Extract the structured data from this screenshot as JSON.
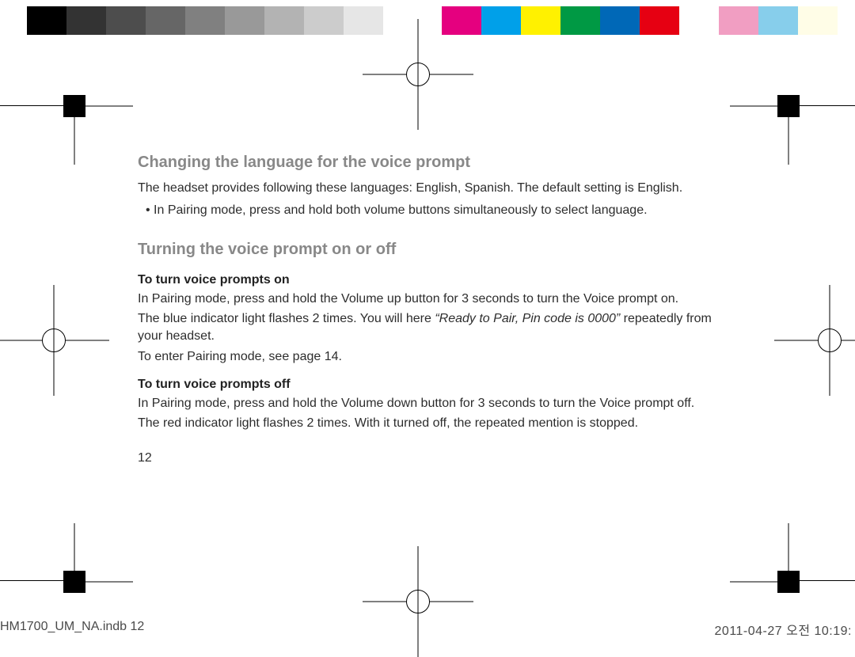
{
  "colorbar": {
    "left": [
      "#000000",
      "#333333",
      "#4d4d4d",
      "#666666",
      "#808080",
      "#999999",
      "#b3b3b3",
      "#cccccc",
      "#e6e6e6",
      "#ffffff"
    ],
    "right": [
      "#e5007f",
      "#00a0e9",
      "#fff100",
      "#009944",
      "#0068b7",
      "#e60012",
      "#ffffff",
      "#f19ec2",
      "#87ceeb",
      "#fffde7"
    ]
  },
  "headings": {
    "h1": "Changing the language for the voice prompt",
    "h2": "Turning the voice prompt on or off"
  },
  "section1": {
    "intro": "The headset provides following these languages: English, Spanish. The default setting is English.",
    "bullet": "In Pairing mode, press and hold both volume buttons simultaneously to select language."
  },
  "section2": {
    "on_title": "To turn voice prompts on",
    "on_p1": "In Pairing mode, press and hold the Volume up button for 3 seconds to turn the Voice prompt on.",
    "on_p2a": "The blue indicator light flashes 2 times. You will here ",
    "on_p2_italic": "“Ready to Pair, Pin code is 0000”",
    "on_p2b": " repeatedly from your headset.",
    "on_p3": "To enter Pairing mode, see page 14.",
    "off_title": "To turn voice prompts off",
    "off_p1": "In Pairing mode, press and hold the Volume down button for 3 seconds to turn the Voice prompt off.",
    "off_p2": "The red indicator light flashes 2 times. With it turned off, the repeated mention is stopped."
  },
  "page_number": "12",
  "footer": {
    "left": "HM1700_UM_NA.indb   12",
    "right": "2011-04-27   오전 10:19:"
  }
}
